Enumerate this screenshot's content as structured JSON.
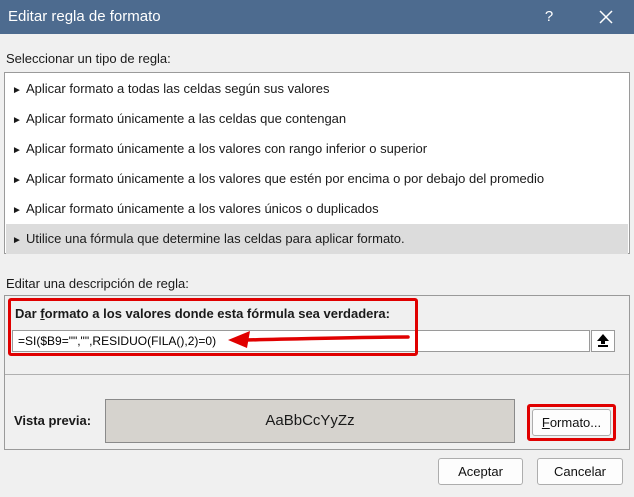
{
  "window": {
    "title": "Editar regla de formato",
    "help_label": "?",
    "close_icon": "close-icon"
  },
  "rule_types": {
    "label": "Seleccionar un tipo de regla:",
    "items": [
      {
        "label": "Aplicar formato a todas las celdas según sus valores",
        "selected": false
      },
      {
        "label": "Aplicar formato únicamente a las celdas que contengan",
        "selected": false
      },
      {
        "label": "Aplicar formato únicamente a los valores con rango inferior o superior",
        "selected": false
      },
      {
        "label": "Aplicar formato únicamente a los valores que estén por encima o por debajo del promedio",
        "selected": false
      },
      {
        "label": "Aplicar formato únicamente a los valores únicos o duplicados",
        "selected": false
      },
      {
        "label": "Utilice una fórmula que determine las celdas para aplicar formato.",
        "selected": true
      }
    ]
  },
  "description": {
    "label": "Editar una descripción de regla:",
    "formula_label_pre": "Dar ",
    "formula_label_accel": "f",
    "formula_label_post": "ormato a los valores donde esta fórmula sea verdadera:",
    "formula_value": "=SI($B9=\"\",\"\",RESIDUO(FILA(),2)=0)"
  },
  "preview": {
    "label": "Vista previa:",
    "sample_text": "AaBbCcYyZz",
    "format_button_accel": "F",
    "format_button_rest": "ormato..."
  },
  "buttons": {
    "ok": "Aceptar",
    "cancel": "Cancelar"
  },
  "colors": {
    "titlebar": "#4d6b8f",
    "highlight": "#e00000",
    "selected_row": "#dcdcdc"
  }
}
